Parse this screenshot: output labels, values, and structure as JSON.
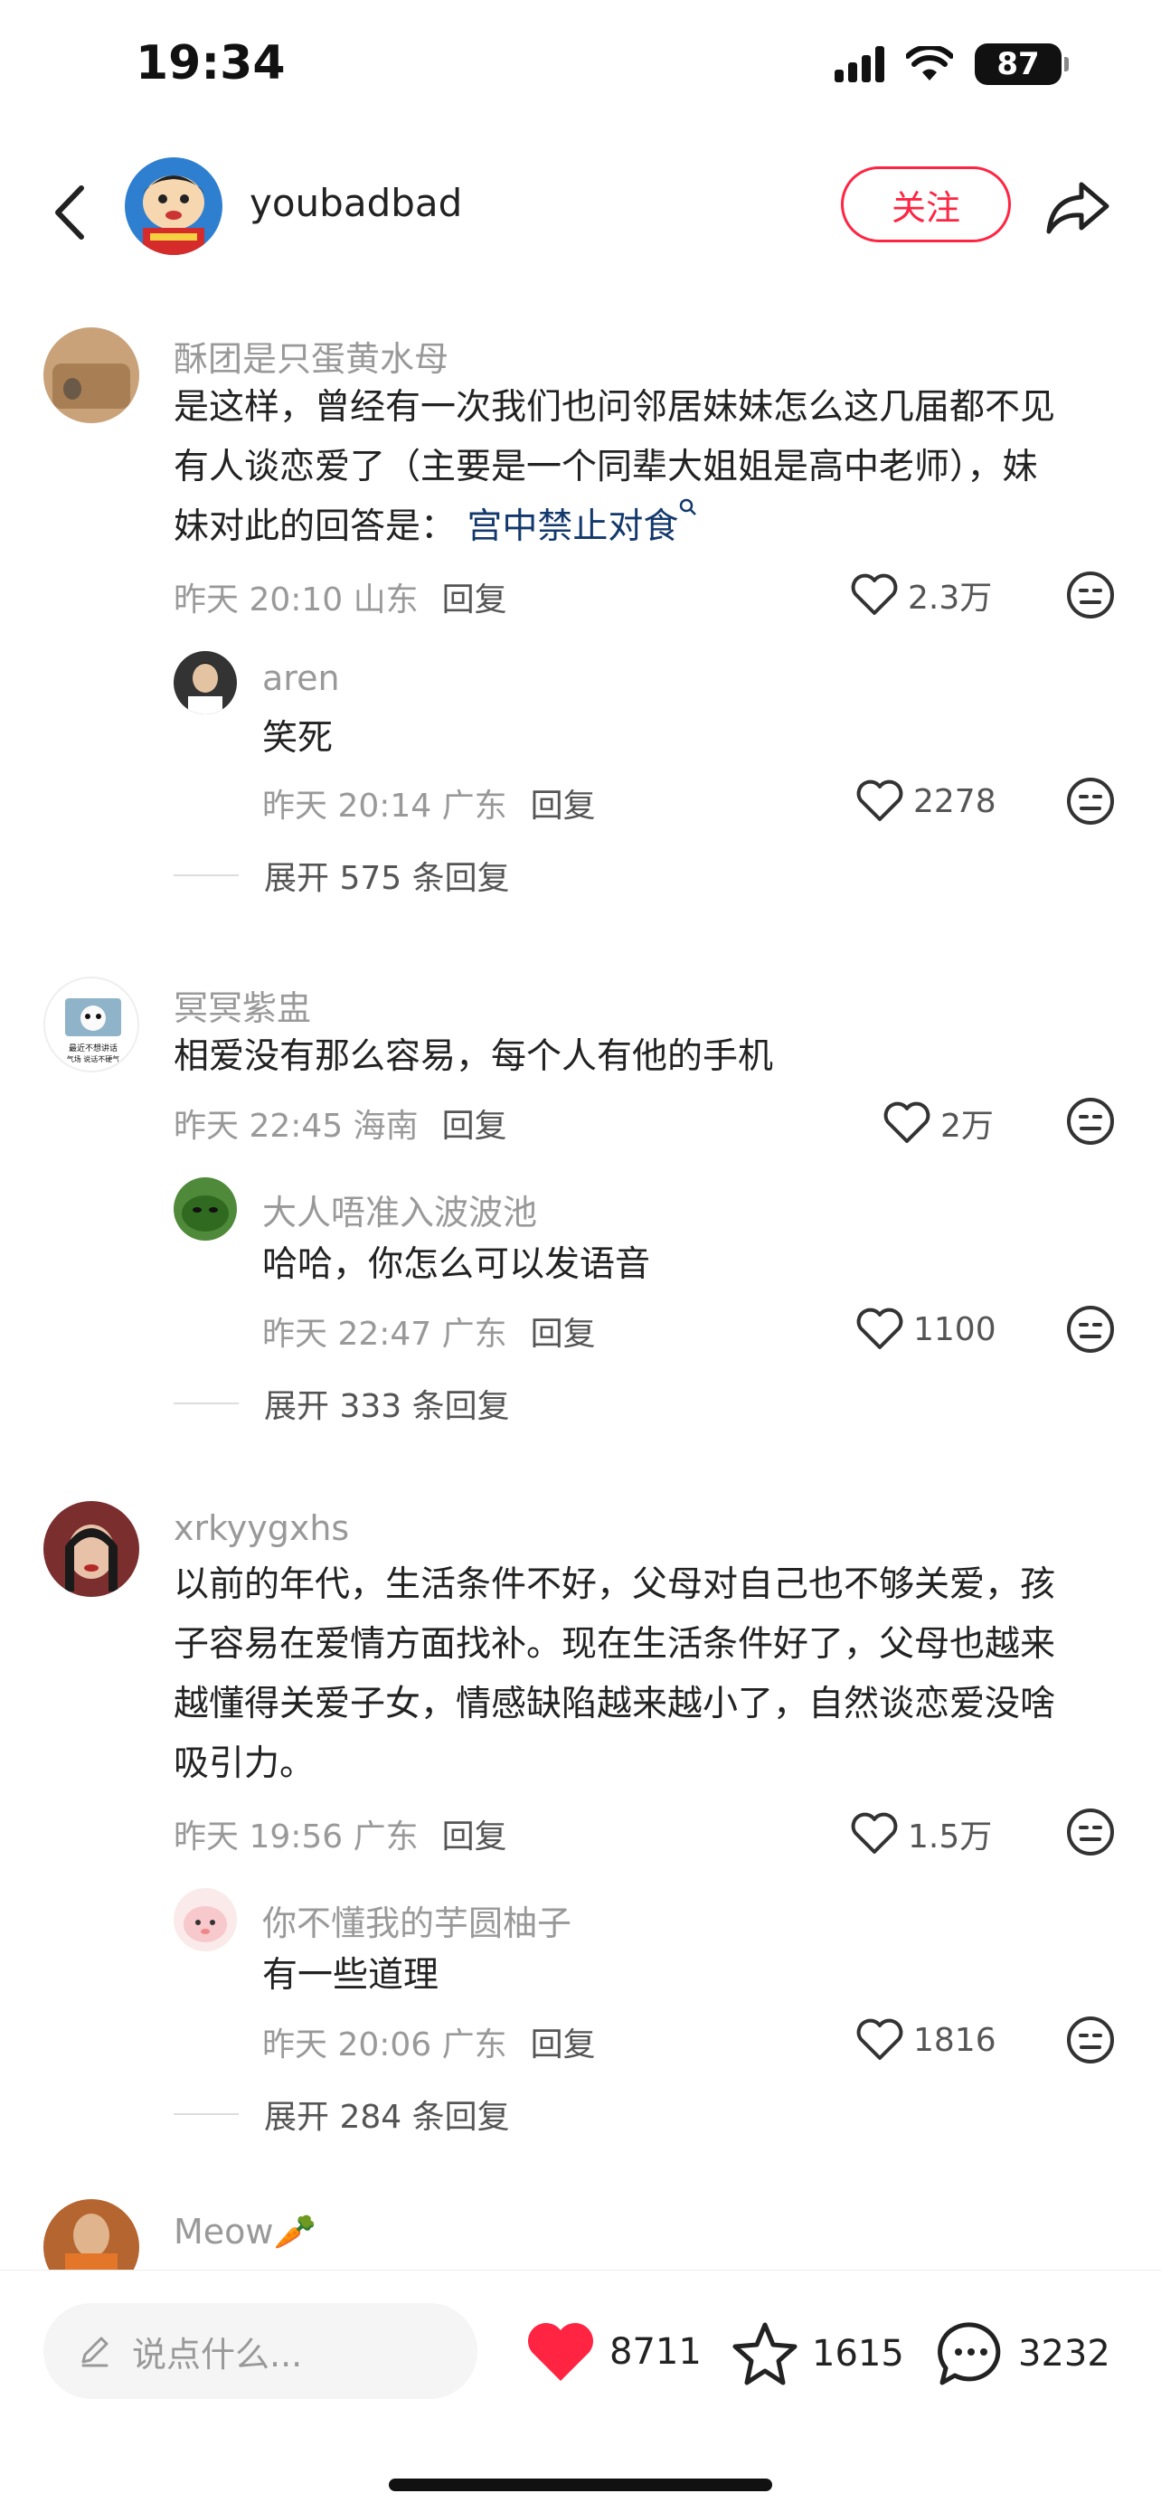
{
  "status": {
    "time": "19:34",
    "battery": "87"
  },
  "header": {
    "username": "youbadbad",
    "follow_label": "关注"
  },
  "comments": [
    {
      "user": "酥团是只蛋黄水母",
      "text_lines": [
        "是这样，曾经有一次我们也问邻居妹妹怎么这几届都不见",
        "有人谈恋爱了（主要是一个同辈大姐姐是高中老师），妹"
      ],
      "text_last": "妹对此的回答是：",
      "link": "宫中禁止对食",
      "time": "昨天 20:10 山东",
      "reply_label": "回复",
      "likes": "2.3万",
      "reply": {
        "user": "aren",
        "text": "笑死",
        "time": "昨天 20:14 广东",
        "reply_label": "回复",
        "likes": "2278"
      },
      "expand": "展开 575 条回复"
    },
    {
      "user": "冥冥紫盅",
      "text": "相爱没有那么容易，每个人有他的手机",
      "avatar_caption_1": "最近不想讲话",
      "avatar_caption_2": "气场 说话不硬气",
      "time": "昨天 22:45 海南",
      "reply_label": "回复",
      "likes": "2万",
      "reply": {
        "user": "大人唔准入波波池",
        "text": "哈哈，你怎么可以发语音",
        "time": "昨天 22:47 广东",
        "reply_label": "回复",
        "likes": "1100"
      },
      "expand": "展开 333 条回复"
    },
    {
      "user": "xrkyygxhs",
      "text_lines": [
        "以前的年代，生活条件不好，父母对自己也不够关爱，孩",
        "子容易在爱情方面找补。现在生活条件好了，父母也越来",
        "越懂得关爱子女，情感缺陷越来越小了，自然谈恋爱没啥",
        "吸引力。"
      ],
      "time": "昨天 19:56 广东",
      "reply_label": "回复",
      "likes": "1.5万",
      "reply": {
        "user": "你不懂我的芋圆柚子",
        "text": "有一些道理",
        "time": "昨天 20:06 广东",
        "reply_label": "回复",
        "likes": "1816"
      },
      "expand": "展开 284 条回复"
    },
    {
      "user": "Meow🥕"
    }
  ],
  "bottom": {
    "placeholder": "说点什么...",
    "likes": "8711",
    "favorites": "1615",
    "comments": "3232"
  },
  "colors": {
    "accent": "#ff2442",
    "link": "#13386c",
    "muted": "#999999"
  }
}
